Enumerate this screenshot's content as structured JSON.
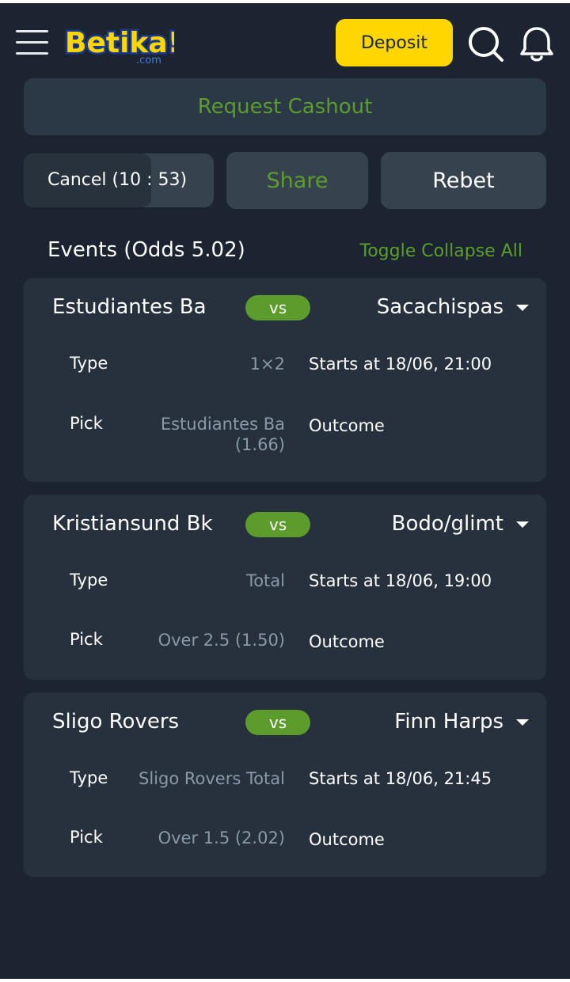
{
  "header": {
    "logo_main": "Betika!",
    "logo_sub": ".com",
    "deposit_label": "Deposit"
  },
  "cashout_label": "Request Cashout",
  "actions": {
    "cancel_label": "Cancel (10 : 53)",
    "cancel_progress": 0.67,
    "share_label": "Share",
    "rebet_label": "Rebet"
  },
  "events_header": {
    "title": "Events (Odds 5.02)",
    "toggle_label": "Toggle Collapse All"
  },
  "events": [
    {
      "home": "Estudiantes Ba",
      "vs": "vs",
      "away": "Sacachispas",
      "type_label": "Type",
      "type_value": "1×2",
      "pick_label": "Pick",
      "pick_value": "Estudiantes Ba (1.66)",
      "starts": "Starts at 18/06, 21:00",
      "outcome": "Outcome"
    },
    {
      "home": "Kristiansund Bk",
      "vs": "vs",
      "away": "Bodo/glimt",
      "type_label": "Type",
      "type_value": "Total",
      "pick_label": "Pick",
      "pick_value": "Over 2.5 (1.50)",
      "starts": "Starts at 18/06, 19:00",
      "outcome": "Outcome"
    },
    {
      "home": "Sligo Rovers",
      "vs": "vs",
      "away": "Finn Harps",
      "type_label": "Type",
      "type_value": "Sligo Rovers Total",
      "pick_label": "Pick",
      "pick_value": "Over 1.5 (2.02)",
      "starts": "Starts at 18/06, 21:45",
      "outcome": "Outcome"
    }
  ],
  "colors": {
    "background": "#1b2430",
    "card": "#26313d",
    "accent_green": "#5c9c2d",
    "deposit_yellow": "#ffd600"
  }
}
